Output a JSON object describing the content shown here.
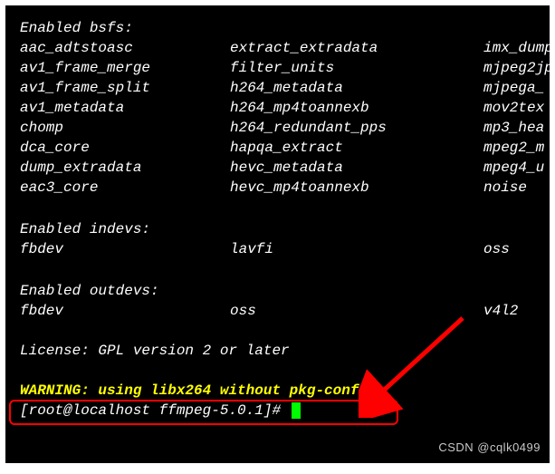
{
  "sections": {
    "bsfs": {
      "header": "Enabled bsfs:",
      "rows": [
        {
          "c1": "aac_adtstoasc",
          "c2": "extract_extradata",
          "c3": "imx_dump"
        },
        {
          "c1": "av1_frame_merge",
          "c2": "filter_units",
          "c3": "mjpeg2jp"
        },
        {
          "c1": "av1_frame_split",
          "c2": "h264_metadata",
          "c3": "mjpega_"
        },
        {
          "c1": "av1_metadata",
          "c2": "h264_mp4toannexb",
          "c3": "mov2tex"
        },
        {
          "c1": "chomp",
          "c2": "h264_redundant_pps",
          "c3": "mp3_hea"
        },
        {
          "c1": "dca_core",
          "c2": "hapqa_extract",
          "c3": "mpeg2_m"
        },
        {
          "c1": "dump_extradata",
          "c2": "hevc_metadata",
          "c3": "mpeg4_u"
        },
        {
          "c1": "eac3_core",
          "c2": "hevc_mp4toannexb",
          "c3": "noise"
        }
      ]
    },
    "indevs": {
      "header": "Enabled indevs:",
      "rows": [
        {
          "c1": "fbdev",
          "c2": "lavfi",
          "c3": "oss"
        }
      ]
    },
    "outdevs": {
      "header": "Enabled outdevs:",
      "rows": [
        {
          "c1": "fbdev",
          "c2": "oss",
          "c3": "v4l2"
        }
      ]
    }
  },
  "license": "License: GPL version 2 or later",
  "warning": "WARNING: using libx264 without pkg-config",
  "prompt": "[root@localhost ffmpeg-5.0.1]# ",
  "watermark": "CSDN @cqlk0499"
}
